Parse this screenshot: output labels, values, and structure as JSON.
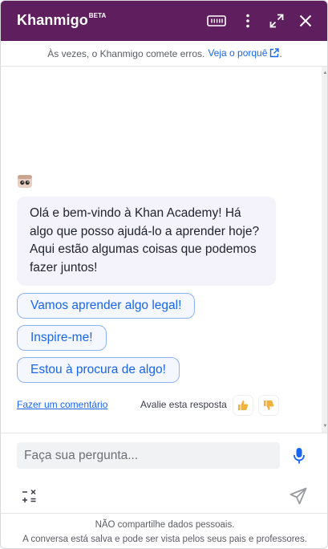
{
  "header": {
    "title": "Khanmigo",
    "badge": "BETA",
    "background": "#5f1f5f",
    "icons": [
      "keyboard-icon",
      "more-vertical-icon",
      "expand-icon",
      "close-icon"
    ]
  },
  "disclaimer": {
    "text": "Às vezes, o Khanmigo comete erros.",
    "link": "Veja o porquê",
    "suffix": "."
  },
  "chat": {
    "greeting": "Olá e bem-vindo à Khan Academy! Há algo que posso ajudá-lo a aprender hoje? Aqui estão algumas coisas que podemos fazer juntos!",
    "suggestions": [
      "Vamos aprender algo legal!",
      "Inspire-me!",
      "Estou à procura de algo!"
    ],
    "feedback_link": "Fazer um comentário",
    "rate_label": "Avalie esta resposta"
  },
  "input": {
    "placeholder": "Faça sua pergunta..."
  },
  "footer": {
    "line1": "NÃO compartilhe dados pessoais.",
    "line2": "A conversa está salva e pode ser vista pelos seus pais e professores."
  },
  "colors": {
    "accent": "#1865f2",
    "bubble": "#f4f2fb",
    "header": "#5f1f5f"
  }
}
